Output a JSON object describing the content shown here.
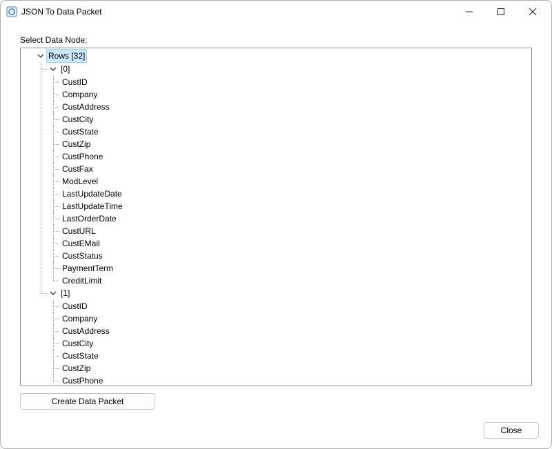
{
  "window": {
    "title": "JSON To Data Packet"
  },
  "content": {
    "label": "Select Data Node:"
  },
  "tree": {
    "root_label": "Rows [32]",
    "nodes": [
      {
        "label": "[0]",
        "children": [
          "CustID",
          "Company",
          "CustAddress",
          "CustCity",
          "CustState",
          "CustZip",
          "CustPhone",
          "CustFax",
          "ModLevel",
          "LastUpdateDate",
          "LastUpdateTime",
          "LastOrderDate",
          "CustURL",
          "CustEMail",
          "CustStatus",
          "PaymentTerm",
          "CreditLimit"
        ]
      },
      {
        "label": "[1]",
        "children": [
          "CustID",
          "Company",
          "CustAddress",
          "CustCity",
          "CustState",
          "CustZip",
          "CustPhone"
        ]
      }
    ]
  },
  "buttons": {
    "create": "Create Data Packet",
    "close": "Close"
  }
}
